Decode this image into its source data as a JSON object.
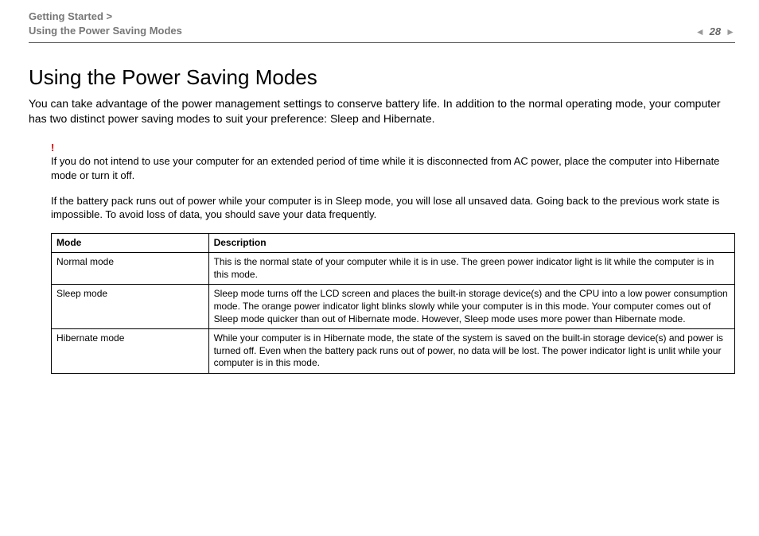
{
  "header": {
    "breadcrumb_line1": "Getting Started >",
    "breadcrumb_line2": "Using the Power Saving Modes",
    "page_number": "28"
  },
  "title": "Using the Power Saving Modes",
  "intro": "You can take advantage of the power management settings to conserve battery life. In addition to the normal operating mode, your computer has two distinct power saving modes to suit your preference: Sleep and Hibernate.",
  "alert_mark": "!",
  "alert_text": "If you do not intend to use your computer for an extended period of time while it is disconnected from AC power, place the computer into Hibernate mode or turn it off.",
  "note2": "If the battery pack runs out of power while your computer is in Sleep mode, you will lose all unsaved data. Going back to the previous work state is impossible. To avoid loss of data, you should save your data frequently.",
  "table": {
    "headers": {
      "mode": "Mode",
      "description": "Description"
    },
    "rows": [
      {
        "mode": "Normal mode",
        "description": "This is the normal state of your computer while it is in use. The green power indicator light is lit while the computer is in this mode."
      },
      {
        "mode": "Sleep mode",
        "description": "Sleep mode turns off the LCD screen and places the built-in storage device(s) and the CPU into a low power consumption mode. The orange power indicator light blinks slowly while your computer is in this mode. Your computer comes out of Sleep mode quicker than out of Hibernate mode. However, Sleep mode uses more power than Hibernate mode."
      },
      {
        "mode": "Hibernate mode",
        "description": "While your computer is in Hibernate mode, the state of the system is saved on the built-in storage device(s) and power is turned off. Even when the battery pack runs out of power, no data will be lost. The power indicator light is unlit while your computer is in this mode."
      }
    ]
  }
}
